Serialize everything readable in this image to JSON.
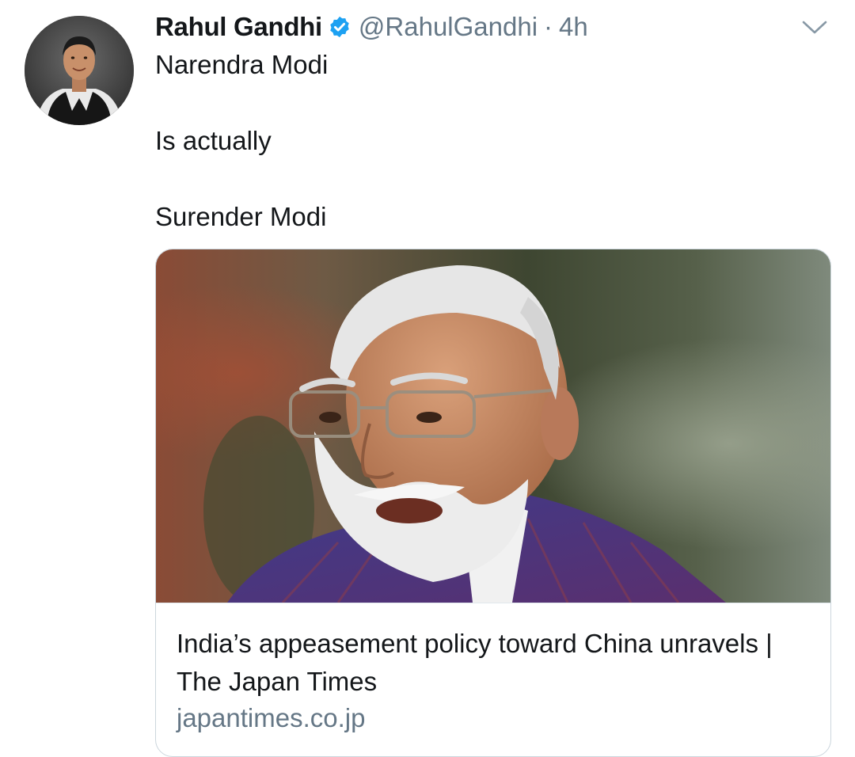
{
  "tweet": {
    "author": {
      "display_name": "Rahul Gandhi",
      "handle": "@RahulGandhi",
      "verified": true,
      "avatar_icon": "profile-photo"
    },
    "separator": "·",
    "timestamp": "4h",
    "menu_icon": "chevron-down-icon",
    "text_lines": [
      "Narendra Modi",
      "Is actually",
      "Surender Modi"
    ],
    "card": {
      "image_icon": "article-thumbnail-photo",
      "title": "India’s appeasement policy toward China unravels | The Japan Times",
      "domain": "japantimes.co.jp"
    }
  },
  "colors": {
    "text_primary": "#14171a",
    "text_secondary": "#657786",
    "verified_blue": "#1da1f2",
    "card_border": "#ccd6dd"
  }
}
